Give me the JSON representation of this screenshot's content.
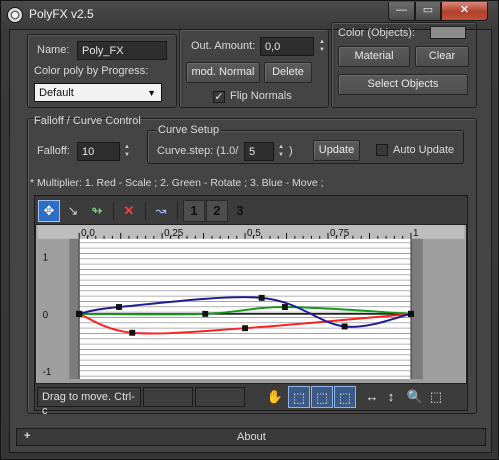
{
  "window": {
    "title": "PolyFX v2.5",
    "minimize_glyph": "—",
    "maximize_glyph": "▭",
    "close_glyph": "✕"
  },
  "general": {
    "name_label": "Name:",
    "name_value": "Poly_FX",
    "color_poly_label": "Color poly by Progress:",
    "color_poly_value": "Default",
    "out_amount_label": "Out. Amount:",
    "out_amount_value": "0,0",
    "mod_normal_label": "mod. Normal",
    "delete_label": "Delete",
    "flip_normals_label": "Flip Normals",
    "flip_normals_checked": true,
    "color_objects_label": "Color (Objects):",
    "material_label": "Material",
    "clear_label": "Clear",
    "select_objects_label": "Select Objects"
  },
  "falloff": {
    "rollout_title": "Falloff / Curve Control",
    "falloff_label": "Falloff:",
    "falloff_value": "10",
    "curve_setup_title": "Curve Setup",
    "curve_step_label": "Curve.step: (1.0/",
    "curve_step_value": "5",
    "curve_step_suffix": ")",
    "update_label": "Update",
    "auto_update_label": "Auto Update",
    "auto_update_checked": false,
    "multiplier_note": "* Multiplier:  1. Red - Scale ; 2. Green - Rotate ; 3. Blue - Move ;"
  },
  "curve_editor": {
    "toolbar": {
      "move_icon": "move-icon",
      "scale_icon": "scale-icon",
      "insert_icon": "insert-point-icon",
      "delete_icon": "delete-point-icon",
      "reset_icon": "reset-curve-icon",
      "curve_buttons": [
        "1",
        "2",
        "3"
      ]
    },
    "x_ticks": [
      "0,0",
      "0,25",
      "0,5",
      "0,75",
      "1"
    ],
    "y_ticks": [
      "1",
      "0",
      "-1"
    ],
    "status_text": "Drag to move. Ctrl-c",
    "colors": {
      "red": "#ff2020",
      "green": "#15981c",
      "blue": "#1c1c9a",
      "background": "#ffffff",
      "grid": "#9a9a9a"
    },
    "chart_data": {
      "type": "line",
      "xlim": [
        0,
        1
      ],
      "ylim": [
        -1,
        1
      ],
      "series": [
        {
          "name": "Red - Scale",
          "points": [
            [
              0,
              0
            ],
            [
              0.16,
              -0.33
            ],
            [
              0.5,
              -0.25
            ],
            [
              1,
              0
            ]
          ]
        },
        {
          "name": "Green - Rotate",
          "points": [
            [
              0,
              0
            ],
            [
              0.38,
              0
            ],
            [
              0.62,
              0.12
            ],
            [
              1,
              0
            ]
          ]
        },
        {
          "name": "Blue - Move",
          "points": [
            [
              0,
              0
            ],
            [
              0.12,
              0.12
            ],
            [
              0.55,
              0.28
            ],
            [
              0.8,
              -0.22
            ],
            [
              1,
              0
            ]
          ]
        }
      ]
    }
  },
  "about": {
    "plus_glyph": "+",
    "label": "About"
  }
}
